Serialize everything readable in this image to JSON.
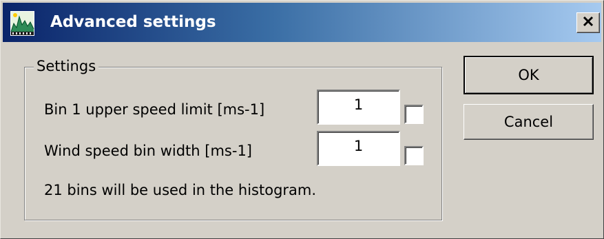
{
  "window": {
    "title": "Advanced settings",
    "icon": "app-chart-icon",
    "close_icon": "close-icon"
  },
  "settings": {
    "group_label": "Settings",
    "fields": [
      {
        "label": "Bin 1 upper speed limit [ms-1]",
        "value": "1",
        "checked": false
      },
      {
        "label": "Wind speed bin width [ms-1]",
        "value": "1",
        "checked": false
      }
    ],
    "info_text": "21 bins will be used in the histogram."
  },
  "buttons": {
    "ok_label": "OK",
    "cancel_label": "Cancel"
  },
  "colors": {
    "titlebar_start": "#0a246a",
    "titlebar_end": "#a6caf0",
    "dialog_face": "#d4d0c8"
  }
}
